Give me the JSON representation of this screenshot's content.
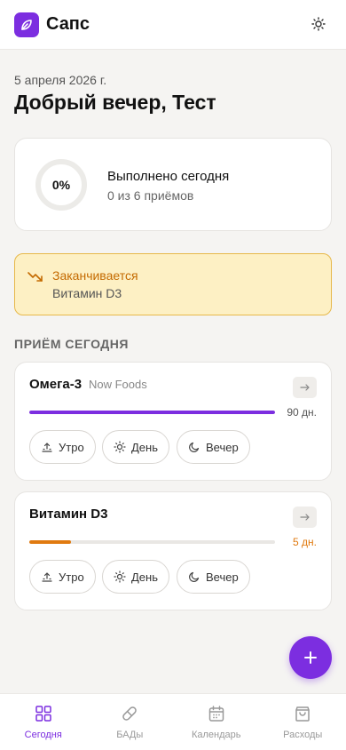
{
  "header": {
    "app_title": "Сапс",
    "logo_icon": "leaf-icon",
    "theme_icon": "sun-icon"
  },
  "greeting": {
    "date": "5 апреля 2026 г.",
    "text": "Добрый вечер, Тест"
  },
  "progress": {
    "percent_label": "0%",
    "percent": 0,
    "title": "Выполнено сегодня",
    "subtitle": "0 из 6 приёмов"
  },
  "alert": {
    "title": "Заканчивается",
    "item": "Витамин D3",
    "icon": "trending-down-icon",
    "color": "#c46a00"
  },
  "section_title": "ПРИЁМ СЕГОДНЯ",
  "supplements": [
    {
      "name": "Омега-3",
      "brand": "Now Foods",
      "days": "90 дн.",
      "remaining_fraction": 1.0,
      "bar_color": "#7c2ee0",
      "days_color": "#555555",
      "times": [
        "Утро",
        "День",
        "Вечер"
      ]
    },
    {
      "name": "Витамин D3",
      "brand": "",
      "days": "5 дн.",
      "remaining_fraction": 0.17,
      "bar_color": "#e07a10",
      "days_color": "#e07a10",
      "times": [
        "Утро",
        "День",
        "Вечер"
      ]
    }
  ],
  "nav": [
    {
      "label": "Сегодня",
      "icon": "grid-icon",
      "active": true
    },
    {
      "label": "БАДы",
      "icon": "pill-icon",
      "active": false
    },
    {
      "label": "Календарь",
      "icon": "calendar-icon",
      "active": false
    },
    {
      "label": "Расходы",
      "icon": "shopping-bag-icon",
      "active": false
    }
  ],
  "colors": {
    "accent": "#7c2ee0",
    "warning_bg": "#fdf0c4",
    "warning_border": "#e7b84a"
  }
}
